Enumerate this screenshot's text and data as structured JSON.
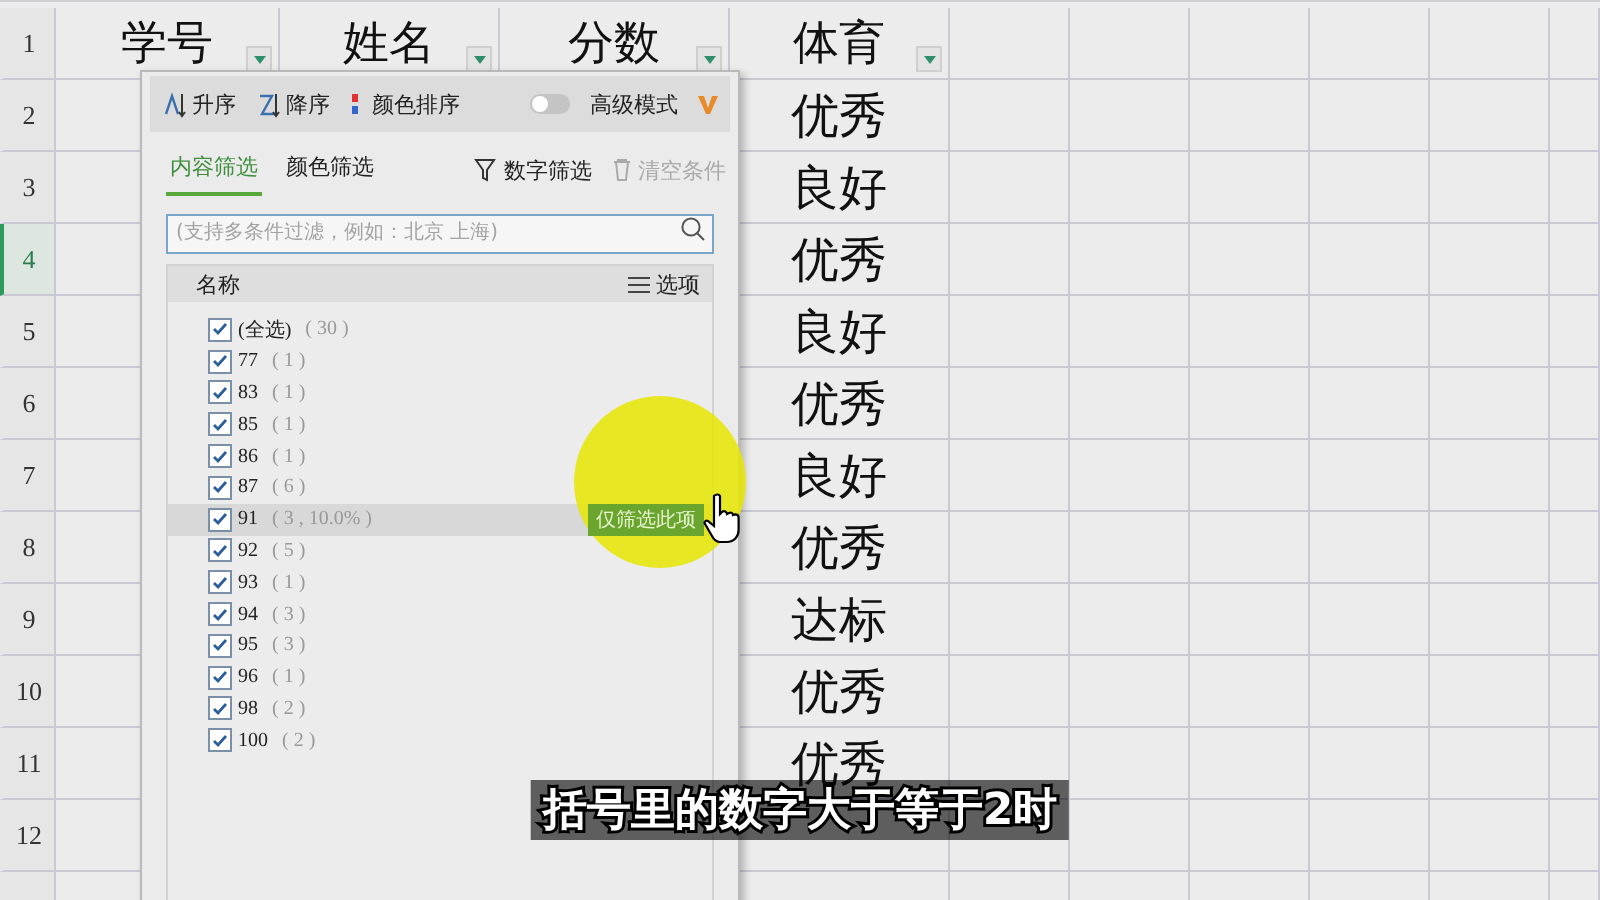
{
  "sheet": {
    "header_row": {
      "number": "1",
      "cells": [
        "学号",
        "姓名",
        "分数",
        "体育"
      ]
    },
    "rows": [
      {
        "number": "2",
        "selected": false,
        "sport": "优秀"
      },
      {
        "number": "3",
        "selected": false,
        "sport": "良好"
      },
      {
        "number": "4",
        "selected": true,
        "sport": "优秀"
      },
      {
        "number": "5",
        "selected": false,
        "sport": "良好"
      },
      {
        "number": "6",
        "selected": false,
        "sport": "优秀"
      },
      {
        "number": "7",
        "selected": false,
        "sport": "良好"
      },
      {
        "number": "8",
        "selected": false,
        "sport": "优秀"
      },
      {
        "number": "9",
        "selected": false,
        "sport": "达标"
      },
      {
        "number": "10",
        "selected": false,
        "sport": "优秀"
      },
      {
        "number": "11",
        "selected": false,
        "sport": "优秀"
      },
      {
        "number": "12",
        "selected": false
      }
    ]
  },
  "filter_panel": {
    "sort_buttons": [
      "升序",
      "降序",
      "颜色排序"
    ],
    "advanced_mode": {
      "label": "高级模式",
      "on": false
    },
    "tabs": [
      {
        "label": "内容筛选",
        "selected": true
      },
      {
        "label": "颜色筛选",
        "selected": false
      }
    ],
    "number_filter": "数字筛选",
    "clear": {
      "label": "清空条件",
      "disabled": true
    },
    "search": {
      "placeholder": "(支持多条件过滤，例如：北京 上海)"
    },
    "list_header": {
      "name": "名称",
      "options": "选项"
    },
    "items": [
      {
        "value": "(全选)",
        "count": "( 30 )",
        "checked": true,
        "hovered": false
      },
      {
        "value": "77",
        "count": "( 1 )",
        "checked": true,
        "hovered": false
      },
      {
        "value": "83",
        "count": "( 1 )",
        "checked": true,
        "hovered": false
      },
      {
        "value": "85",
        "count": "( 1 )",
        "checked": true,
        "hovered": false
      },
      {
        "value": "86",
        "count": "( 1 )",
        "checked": true,
        "hovered": false
      },
      {
        "value": "87",
        "count": "( 6 )",
        "checked": true,
        "hovered": false
      },
      {
        "value": "91",
        "count": "( 3 , 10.0% )",
        "checked": true,
        "hovered": true
      },
      {
        "value": "92",
        "count": "( 5 )",
        "checked": true,
        "hovered": false
      },
      {
        "value": "93",
        "count": "( 1 )",
        "checked": true,
        "hovered": false
      },
      {
        "value": "94",
        "count": "( 3 )",
        "checked": true,
        "hovered": false
      },
      {
        "value": "95",
        "count": "( 3 )",
        "checked": true,
        "hovered": false
      },
      {
        "value": "96",
        "count": "( 1 )",
        "checked": true,
        "hovered": false
      },
      {
        "value": "98",
        "count": "( 2 )",
        "checked": true,
        "hovered": false
      },
      {
        "value": "100",
        "count": "( 2 )",
        "checked": true,
        "hovered": false
      }
    ],
    "only_this_button": "仅筛选此项"
  },
  "caption": "括号里的数字大于等于2时"
}
